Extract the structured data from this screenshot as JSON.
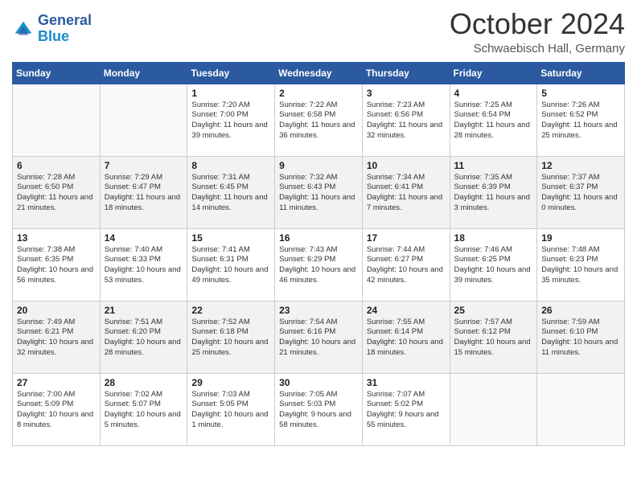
{
  "header": {
    "logo": {
      "line1": "General",
      "line2": "Blue"
    },
    "title": "October 2024",
    "location": "Schwaebisch Hall, Germany"
  },
  "weekdays": [
    "Sunday",
    "Monday",
    "Tuesday",
    "Wednesday",
    "Thursday",
    "Friday",
    "Saturday"
  ],
  "weeks": [
    [
      {
        "day": "",
        "text": ""
      },
      {
        "day": "",
        "text": ""
      },
      {
        "day": "1",
        "text": "Sunrise: 7:20 AM\nSunset: 7:00 PM\nDaylight: 11 hours and 39 minutes."
      },
      {
        "day": "2",
        "text": "Sunrise: 7:22 AM\nSunset: 6:58 PM\nDaylight: 11 hours and 36 minutes."
      },
      {
        "day": "3",
        "text": "Sunrise: 7:23 AM\nSunset: 6:56 PM\nDaylight: 11 hours and 32 minutes."
      },
      {
        "day": "4",
        "text": "Sunrise: 7:25 AM\nSunset: 6:54 PM\nDaylight: 11 hours and 28 minutes."
      },
      {
        "day": "5",
        "text": "Sunrise: 7:26 AM\nSunset: 6:52 PM\nDaylight: 11 hours and 25 minutes."
      }
    ],
    [
      {
        "day": "6",
        "text": "Sunrise: 7:28 AM\nSunset: 6:50 PM\nDaylight: 11 hours and 21 minutes."
      },
      {
        "day": "7",
        "text": "Sunrise: 7:29 AM\nSunset: 6:47 PM\nDaylight: 11 hours and 18 minutes."
      },
      {
        "day": "8",
        "text": "Sunrise: 7:31 AM\nSunset: 6:45 PM\nDaylight: 11 hours and 14 minutes."
      },
      {
        "day": "9",
        "text": "Sunrise: 7:32 AM\nSunset: 6:43 PM\nDaylight: 11 hours and 11 minutes."
      },
      {
        "day": "10",
        "text": "Sunrise: 7:34 AM\nSunset: 6:41 PM\nDaylight: 11 hours and 7 minutes."
      },
      {
        "day": "11",
        "text": "Sunrise: 7:35 AM\nSunset: 6:39 PM\nDaylight: 11 hours and 3 minutes."
      },
      {
        "day": "12",
        "text": "Sunrise: 7:37 AM\nSunset: 6:37 PM\nDaylight: 11 hours and 0 minutes."
      }
    ],
    [
      {
        "day": "13",
        "text": "Sunrise: 7:38 AM\nSunset: 6:35 PM\nDaylight: 10 hours and 56 minutes."
      },
      {
        "day": "14",
        "text": "Sunrise: 7:40 AM\nSunset: 6:33 PM\nDaylight: 10 hours and 53 minutes."
      },
      {
        "day": "15",
        "text": "Sunrise: 7:41 AM\nSunset: 6:31 PM\nDaylight: 10 hours and 49 minutes."
      },
      {
        "day": "16",
        "text": "Sunrise: 7:43 AM\nSunset: 6:29 PM\nDaylight: 10 hours and 46 minutes."
      },
      {
        "day": "17",
        "text": "Sunrise: 7:44 AM\nSunset: 6:27 PM\nDaylight: 10 hours and 42 minutes."
      },
      {
        "day": "18",
        "text": "Sunrise: 7:46 AM\nSunset: 6:25 PM\nDaylight: 10 hours and 39 minutes."
      },
      {
        "day": "19",
        "text": "Sunrise: 7:48 AM\nSunset: 6:23 PM\nDaylight: 10 hours and 35 minutes."
      }
    ],
    [
      {
        "day": "20",
        "text": "Sunrise: 7:49 AM\nSunset: 6:21 PM\nDaylight: 10 hours and 32 minutes."
      },
      {
        "day": "21",
        "text": "Sunrise: 7:51 AM\nSunset: 6:20 PM\nDaylight: 10 hours and 28 minutes."
      },
      {
        "day": "22",
        "text": "Sunrise: 7:52 AM\nSunset: 6:18 PM\nDaylight: 10 hours and 25 minutes."
      },
      {
        "day": "23",
        "text": "Sunrise: 7:54 AM\nSunset: 6:16 PM\nDaylight: 10 hours and 21 minutes."
      },
      {
        "day": "24",
        "text": "Sunrise: 7:55 AM\nSunset: 6:14 PM\nDaylight: 10 hours and 18 minutes."
      },
      {
        "day": "25",
        "text": "Sunrise: 7:57 AM\nSunset: 6:12 PM\nDaylight: 10 hours and 15 minutes."
      },
      {
        "day": "26",
        "text": "Sunrise: 7:59 AM\nSunset: 6:10 PM\nDaylight: 10 hours and 11 minutes."
      }
    ],
    [
      {
        "day": "27",
        "text": "Sunrise: 7:00 AM\nSunset: 5:09 PM\nDaylight: 10 hours and 8 minutes."
      },
      {
        "day": "28",
        "text": "Sunrise: 7:02 AM\nSunset: 5:07 PM\nDaylight: 10 hours and 5 minutes."
      },
      {
        "day": "29",
        "text": "Sunrise: 7:03 AM\nSunset: 5:05 PM\nDaylight: 10 hours and 1 minute."
      },
      {
        "day": "30",
        "text": "Sunrise: 7:05 AM\nSunset: 5:03 PM\nDaylight: 9 hours and 58 minutes."
      },
      {
        "day": "31",
        "text": "Sunrise: 7:07 AM\nSunset: 5:02 PM\nDaylight: 9 hours and 55 minutes."
      },
      {
        "day": "",
        "text": ""
      },
      {
        "day": "",
        "text": ""
      }
    ]
  ]
}
